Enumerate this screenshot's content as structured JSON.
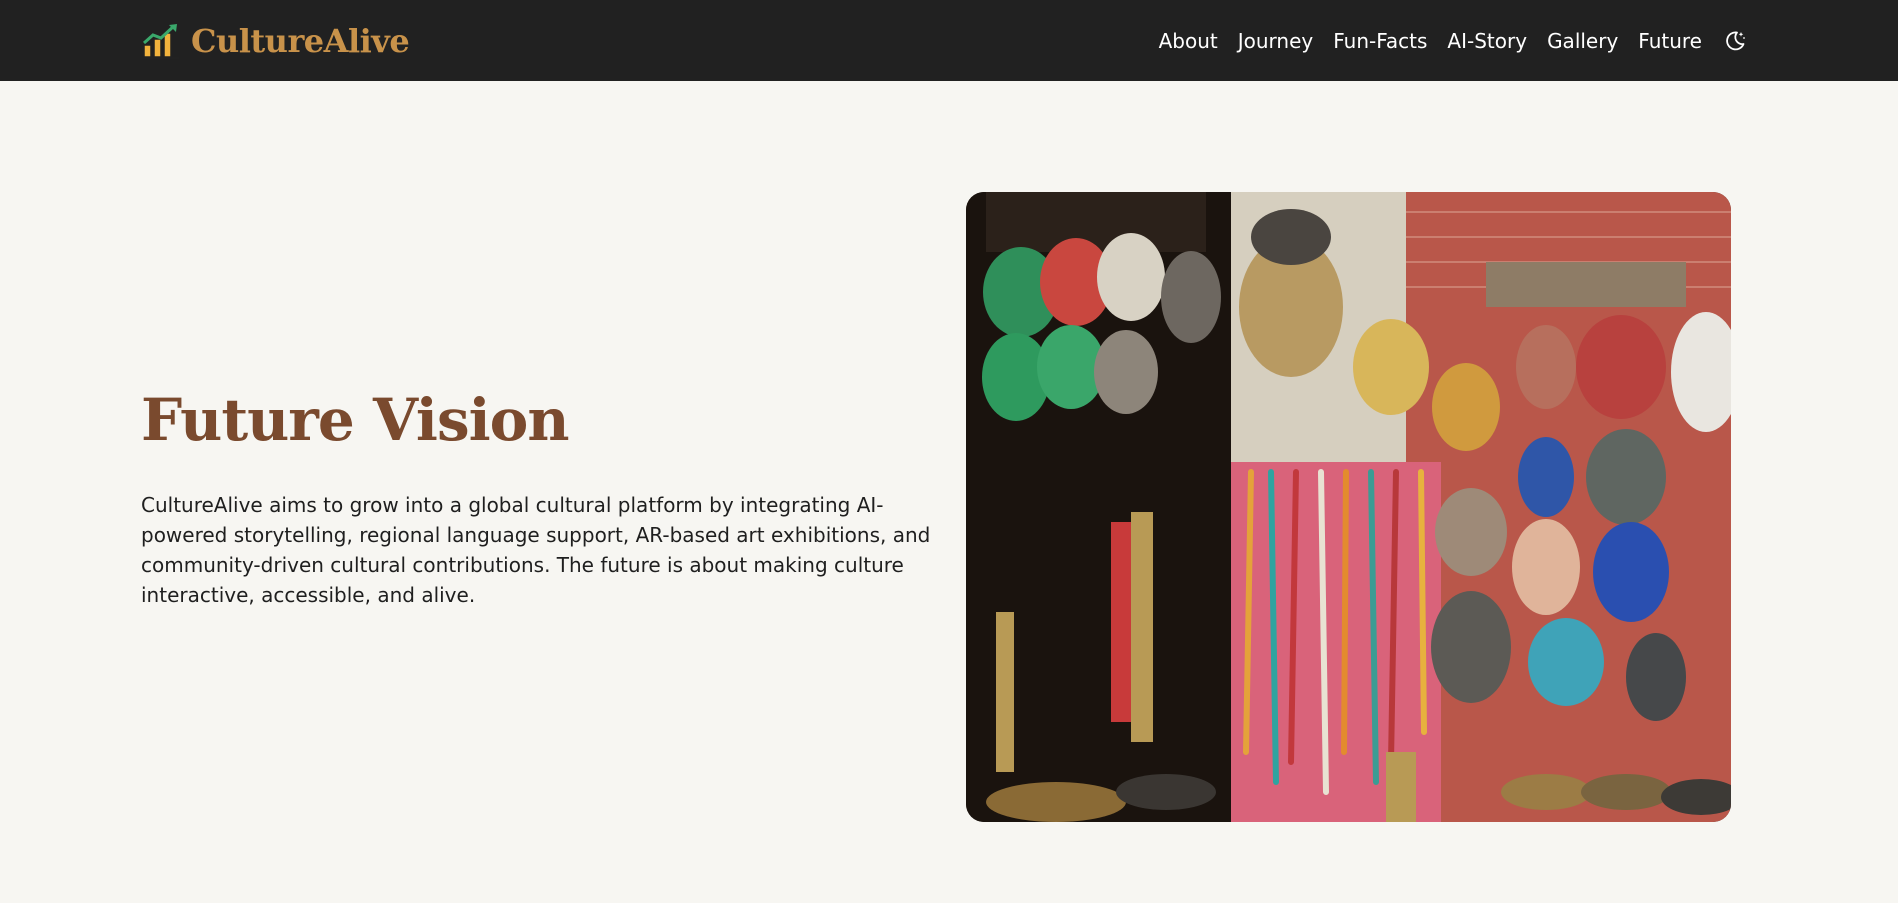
{
  "brand": {
    "name": "CultureAlive",
    "logo_icon": "chart-growth-icon"
  },
  "nav": {
    "items": [
      {
        "label": "About"
      },
      {
        "label": "Journey"
      },
      {
        "label": "Fun-Facts"
      },
      {
        "label": "AI-Story"
      },
      {
        "label": "Gallery"
      },
      {
        "label": "Future"
      }
    ],
    "theme_icon": "moon-stars-icon"
  },
  "hero": {
    "title": "Future Vision",
    "description": "CultureAlive aims to grow into a global cultural platform by integrating AI-powered storytelling, regional language support, AR-based art exhibitions, and community-driven cultural contributions. The future is about making culture interactive, accessible, and alive."
  },
  "colors": {
    "nav_bg": "#212121",
    "brand": "#c8924a",
    "title": "#7a4a2e",
    "page_bg": "#f7f6f2"
  }
}
